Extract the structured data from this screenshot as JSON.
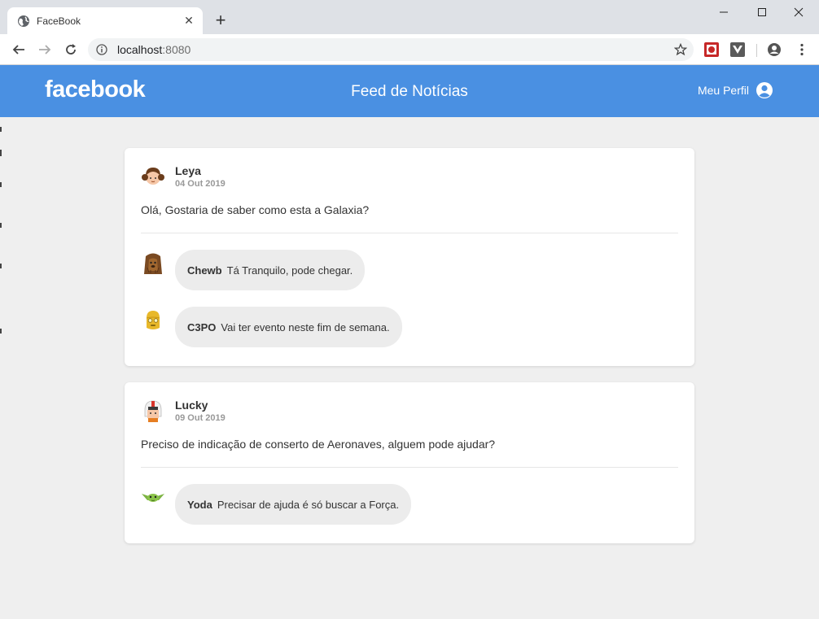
{
  "browser": {
    "tab_title": "FaceBook",
    "new_tab": "+",
    "url_host": "localhost",
    "url_port": ":8080"
  },
  "app": {
    "logo": "facebook",
    "title": "Feed de Notícias",
    "profile_label": "Meu Perfil",
    "header_color": "#4a90e2"
  },
  "posts": [
    {
      "author": "Leya",
      "date": "04 Out 2019",
      "content": "Olá, Gostaria de saber como esta a Galaxia?",
      "avatar_icon": "leia-avatar",
      "comments": [
        {
          "author": "Chewb",
          "text": "Tá Tranquilo, pode chegar.",
          "avatar_icon": "chewbacca-avatar"
        },
        {
          "author": "C3PO",
          "text": "Vai ter evento neste fim de semana.",
          "avatar_icon": "c3po-avatar"
        }
      ]
    },
    {
      "author": "Lucky",
      "date": "09 Out 2019",
      "content": "Preciso de indicação de conserto de Aeronaves, alguem pode ajudar?",
      "avatar_icon": "luke-pilot-avatar",
      "comments": [
        {
          "author": "Yoda",
          "text": "Precisar de ajuda é só buscar a Força.",
          "avatar_icon": "yoda-avatar"
        }
      ]
    }
  ]
}
